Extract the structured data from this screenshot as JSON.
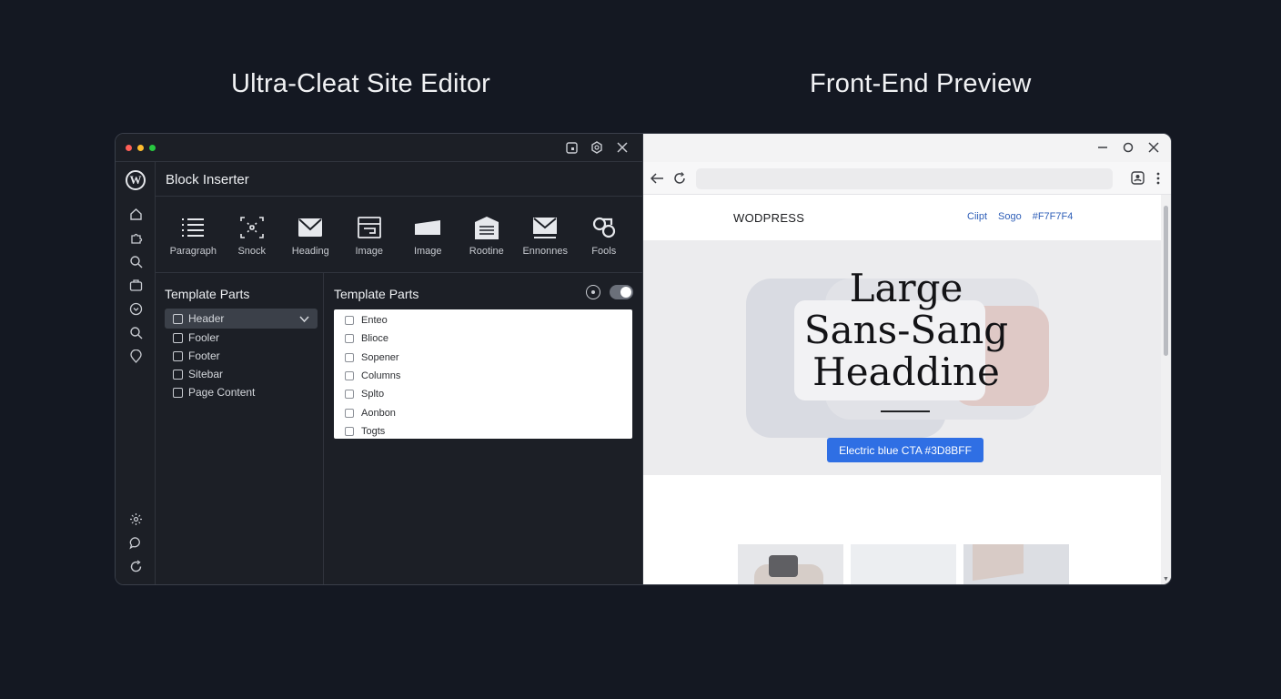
{
  "captions": {
    "left": "Ultra-Cleat Site Editor",
    "right": "Front-End Preview"
  },
  "editor": {
    "traffic_lights": [
      "#ff5f57",
      "#febc2e",
      "#28c840"
    ],
    "inserter_title": "Block Inserter",
    "blocks": [
      {
        "label": "Paragraph",
        "icon": "list-icon"
      },
      {
        "label": "Snock",
        "icon": "selection-icon"
      },
      {
        "label": "Heading",
        "icon": "envelope-icon"
      },
      {
        "label": "Image",
        "icon": "layout-icon"
      },
      {
        "label": "Image",
        "icon": "tag-icon"
      },
      {
        "label": "Rootine",
        "icon": "document-icon"
      },
      {
        "label": "Ennonnes",
        "icon": "mail-check-icon"
      },
      {
        "label": "Fools",
        "icon": "link-icon"
      }
    ],
    "template_parts_left": {
      "title": "Template Parts",
      "items": [
        "Header",
        "Fooler",
        "Footer",
        "Sitebar",
        "Page Content"
      ]
    },
    "template_parts_right": {
      "title": "Template Parts",
      "items": [
        "Enteo",
        "Blioce",
        "Sopener",
        "Columns",
        "Splto",
        "Aonbon",
        "Togts"
      ]
    }
  },
  "preview": {
    "site_logo": "WODPRESS",
    "nav": [
      "Ciipt",
      "Sogo",
      "#F7F7F4"
    ],
    "hero_title": [
      "Large",
      "Sans-Sang",
      "Headdine"
    ],
    "cta": "Electric blue CTA #3D8BFF",
    "cta_color": "#2f6fe4"
  }
}
